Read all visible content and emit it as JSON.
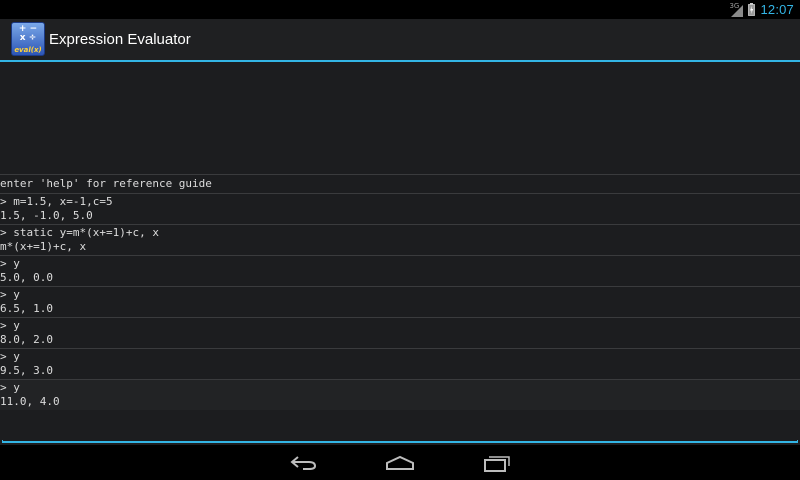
{
  "status_bar": {
    "network_label": "3G",
    "time": "12:07",
    "accent_color": "#33b5e5",
    "icons": [
      "signal-icon",
      "battery-charging-icon"
    ]
  },
  "action_bar": {
    "title": "Expression Evaluator",
    "app_icon": {
      "ops_top": "+ −",
      "ops_bottom": "x ÷",
      "label": "eval(x)"
    }
  },
  "console": {
    "help_text": "enter 'help' for reference guide",
    "entries": [
      {
        "command": "> m=1.5, x=-1,c=5",
        "result": "1.5, -1.0, 5.0"
      },
      {
        "command": "> static y=m*(x+=1)+c, x",
        "result": "m*(x+=1)+c, x"
      },
      {
        "command": "> y",
        "result": "5.0, 0.0"
      },
      {
        "command": "> y",
        "result": "6.5, 1.0"
      },
      {
        "command": "> y",
        "result": "8.0, 2.0"
      },
      {
        "command": "> y",
        "result": "9.5, 3.0"
      },
      {
        "command": "> y",
        "result": "11.0, 4.0"
      }
    ],
    "input_value": ""
  },
  "nav_bar": {
    "icons": [
      "back-icon",
      "home-icon",
      "recent-apps-icon"
    ]
  }
}
